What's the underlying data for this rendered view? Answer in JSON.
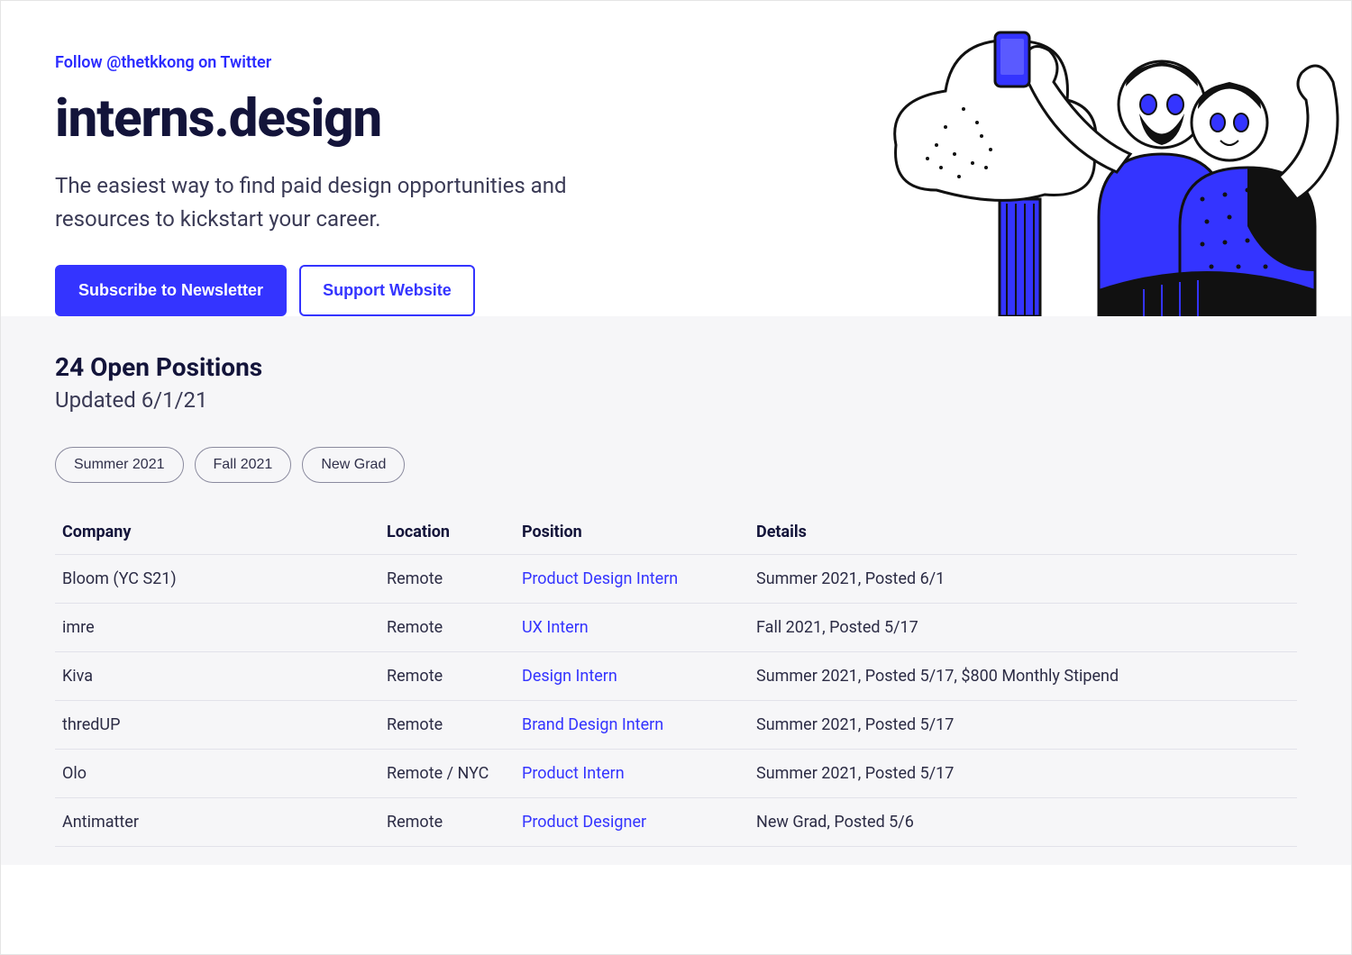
{
  "hero": {
    "twitter_link": "Follow @thetkkong on Twitter",
    "title": "interns.design",
    "subtitle": "The easiest way to find paid design opportunities and resources to kickstart your career.",
    "subscribe_button": "Subscribe to Newsletter",
    "support_button": "Support Website"
  },
  "listings": {
    "positions_heading": "24 Open Positions",
    "updated": "Updated 6/1/21",
    "filters": [
      "Summer 2021",
      "Fall 2021",
      "New Grad"
    ],
    "columns": {
      "company": "Company",
      "location": "Location",
      "position": "Position",
      "details": "Details"
    },
    "rows": [
      {
        "company": "Bloom (YC S21)",
        "location": "Remote",
        "position": "Product Design Intern",
        "details": "Summer 2021, Posted 6/1"
      },
      {
        "company": "imre",
        "location": "Remote",
        "position": "UX Intern",
        "details": "Fall 2021, Posted 5/17"
      },
      {
        "company": "Kiva",
        "location": "Remote",
        "position": "Design Intern",
        "details": "Summer 2021, Posted 5/17, $800 Monthly Stipend"
      },
      {
        "company": "thredUP",
        "location": "Remote",
        "position": "Brand Design Intern",
        "details": "Summer 2021, Posted 5/17"
      },
      {
        "company": "Olo",
        "location": "Remote / NYC",
        "position": "Product Intern",
        "details": "Summer 2021, Posted 5/17"
      },
      {
        "company": "Antimatter",
        "location": "Remote",
        "position": "Product Designer",
        "details": "New Grad, Posted 5/6"
      }
    ]
  }
}
